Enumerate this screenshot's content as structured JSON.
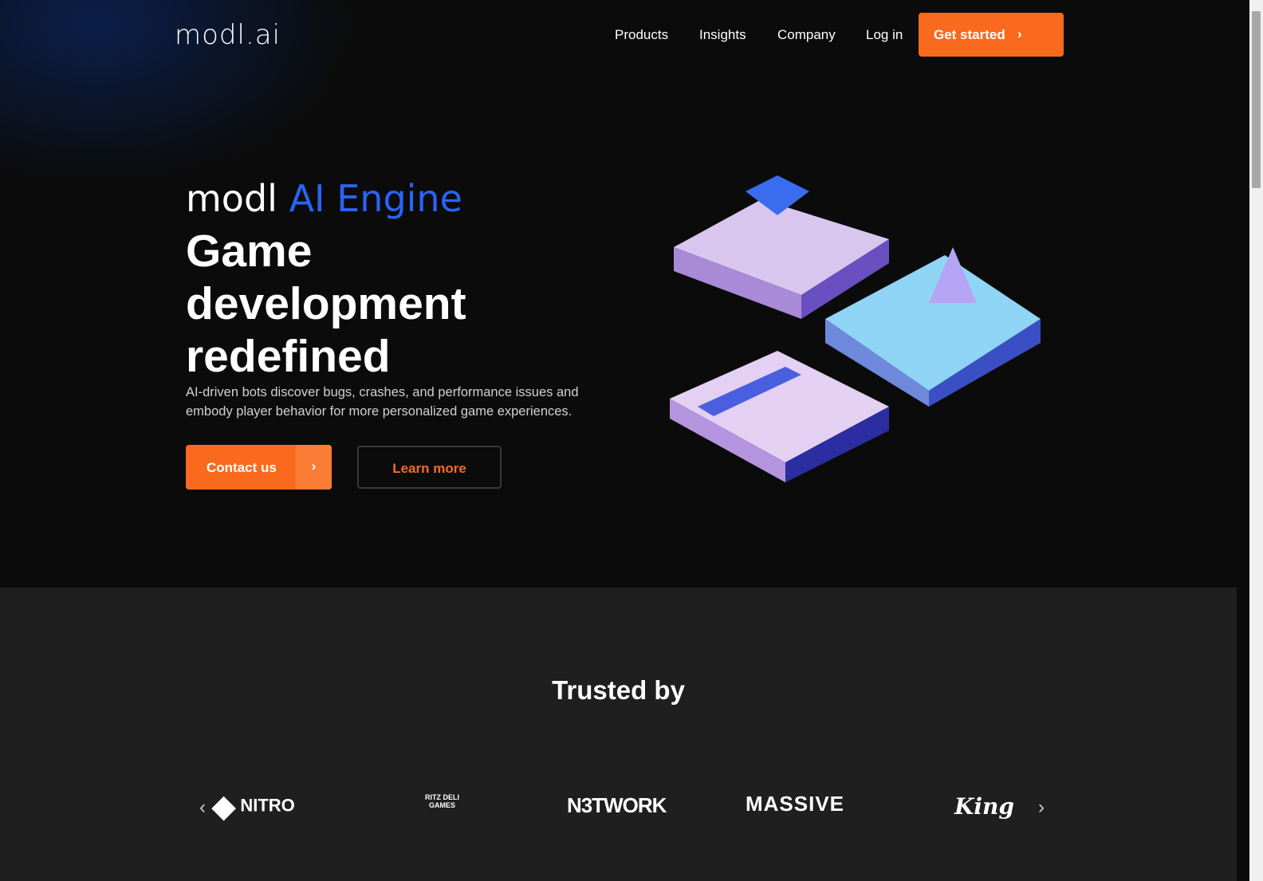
{
  "header": {
    "logo": "modl.ai",
    "nav": [
      "Products",
      "Insights",
      "Company",
      "Log in"
    ],
    "cta": "Get started"
  },
  "hero": {
    "title_prefix": "modl",
    "title_accent": "AI Engine",
    "headline": "Game development redefined",
    "subtitle": "AI-driven bots discover bugs, crashes, and performance issues and embody player behavior for more personalized game experiences.",
    "contact": "Contact us",
    "learn": "Learn more"
  },
  "trusted": {
    "title": "Trusted by",
    "logos": [
      "NITRO",
      "RITZ DELI GAMES",
      "N3TWORK",
      "MASSIVE",
      "King"
    ]
  },
  "colors": {
    "accent": "#fa6a1e",
    "blue": "#2a63f5",
    "bg": "#0b0b0b",
    "section": "#1f1f1f"
  }
}
